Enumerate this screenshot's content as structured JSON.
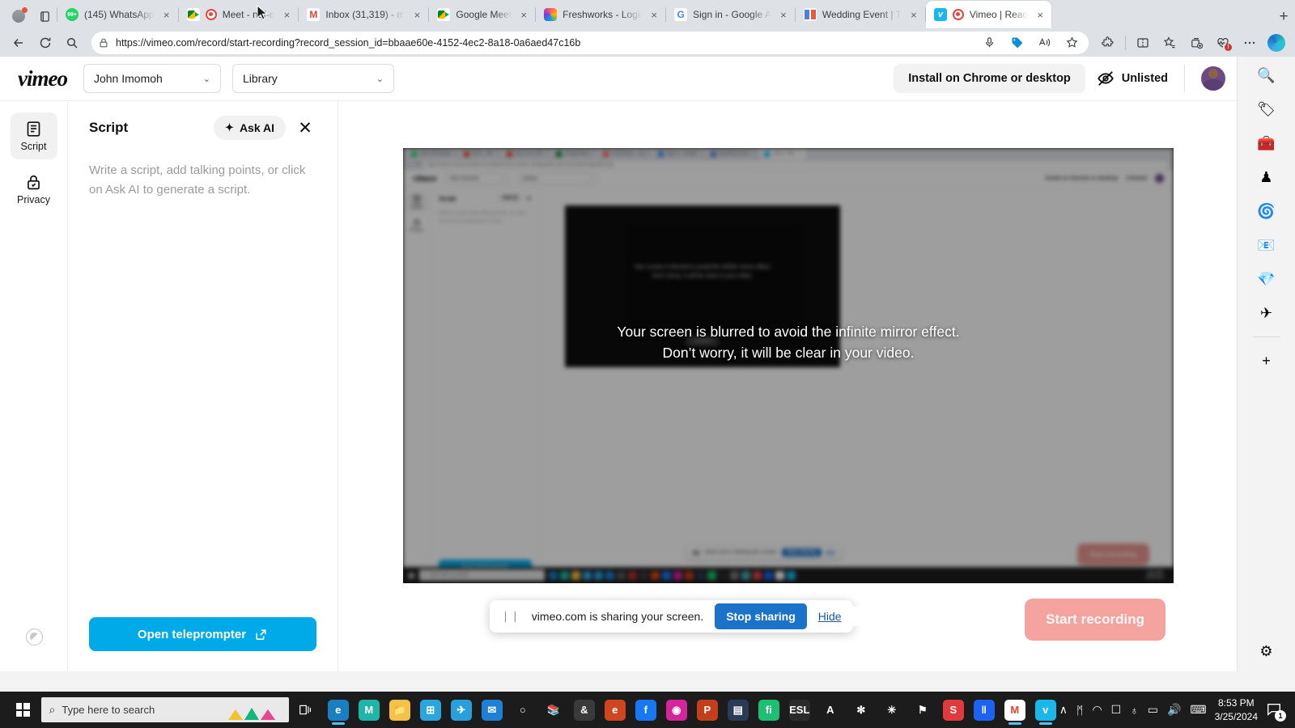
{
  "browser": {
    "tabs": [
      {
        "title": "(145) WhatsApp",
        "favicon": "whatsapp-icon",
        "active": false
      },
      {
        "title": "Meet - nqf-q",
        "favicon": "meet-recording-icon",
        "active": false
      },
      {
        "title": "Inbox (31,319) - m",
        "favicon": "gmail-icon",
        "active": false
      },
      {
        "title": "Google Meet",
        "favicon": "meet-icon",
        "active": false
      },
      {
        "title": "Freshworks - Login",
        "favicon": "freshworks-icon",
        "active": false
      },
      {
        "title": "Sign in - Google A",
        "favicon": "google-icon",
        "active": false
      },
      {
        "title": "Wedding Event | T",
        "favicon": "book-icon",
        "active": false
      },
      {
        "title": "Vimeo | Read",
        "favicon": "vimeo-icon",
        "active": true
      }
    ],
    "tab_close_label": "×",
    "new_tab_label": "+",
    "url": "https://vimeo.com/record/start-recording?record_session_id=bbaae60e-4152-4ec2-8a18-0a6aed47c16b",
    "back_label": "←",
    "refresh_label": "↻",
    "search_label": "⌕"
  },
  "vimeo": {
    "logo": "vimeo",
    "account_select": "John Imomoh",
    "library_select": "Library",
    "caret": "∨",
    "install_button": "Install on Chrome or desktop",
    "privacy_status": "Unlisted",
    "rail": [
      {
        "label": "Script",
        "icon": "script-icon",
        "active": true
      },
      {
        "label": "Privacy",
        "icon": "lock-icon",
        "active": false
      }
    ],
    "script_panel": {
      "title": "Script",
      "ask_ai": "Ask AI",
      "sparkle": "✦",
      "close": "✕",
      "placeholder": "Write a script, add talking points, or click on Ask AI to generate a script.",
      "teleprompter_button": "Open teleprompter"
    },
    "preview": {
      "overlay_line1": "Your screen is blurred to avoid the infinite mirror effect.",
      "overlay_line2": "Don’t worry, it will be clear in your video.",
      "nested_cancel": "Cancel"
    },
    "start_recording": "Start recording"
  },
  "share_bar": {
    "pause_glyph": "❘❘",
    "message": "vimeo.com is sharing your screen.",
    "stop_label": "Stop sharing",
    "hide_label": "Hide"
  },
  "edge_sidebar": {
    "items": [
      {
        "name": "search-icon",
        "glyph": "🔍"
      },
      {
        "name": "shopping-tag-icon",
        "glyph": "🏷"
      },
      {
        "name": "tools-icon",
        "glyph": "🧰"
      },
      {
        "name": "games-icon",
        "glyph": "♟"
      },
      {
        "name": "office-icon",
        "glyph": "🌀"
      },
      {
        "name": "outlook-icon",
        "glyph": "📧"
      },
      {
        "name": "drop-icon",
        "glyph": "💎"
      },
      {
        "name": "telegram-icon",
        "glyph": "✈"
      }
    ],
    "add_label": "+",
    "settings_glyph": "⚙"
  },
  "taskbar": {
    "search_placeholder": "Type here to search",
    "search_glyph": "⌕",
    "apps": [
      {
        "name": "edge-icon",
        "glyph": "e",
        "color": "#1a7fc1",
        "running": true
      },
      {
        "name": "mw-icon",
        "glyph": "M",
        "color": "#1fb5a8",
        "running": false
      },
      {
        "name": "file-explorer-icon",
        "glyph": "📁",
        "color": "#f5c148",
        "running": false
      },
      {
        "name": "microsoft-store-icon",
        "glyph": "⊞",
        "color": "#2aa5dd",
        "running": false
      },
      {
        "name": "telegram-icon",
        "glyph": "✈",
        "color": "#2aa0da",
        "running": false
      },
      {
        "name": "mail-icon",
        "glyph": "✉",
        "color": "#1e7fd6",
        "running": false
      },
      {
        "name": "photos-icon",
        "glyph": "○",
        "color": "#1c1c1c",
        "running": false
      },
      {
        "name": "books-icon",
        "glyph": "📚",
        "color": "#1c1c1c",
        "running": false
      },
      {
        "name": "ampersand-icon",
        "glyph": "&",
        "color": "#3a3a3a",
        "running": false
      },
      {
        "name": "opera-icon",
        "glyph": "e",
        "color": "#cf4520",
        "running": false
      },
      {
        "name": "facebook-icon",
        "glyph": "f",
        "color": "#1877f2",
        "running": false
      },
      {
        "name": "instagram-icon",
        "glyph": "◉",
        "color": "#d6249f",
        "running": false
      },
      {
        "name": "powerpoint-icon",
        "glyph": "P",
        "color": "#c43e1c",
        "running": false
      },
      {
        "name": "news-icon",
        "glyph": "▤",
        "color": "#2b3a55",
        "running": false
      },
      {
        "name": "fiverr-icon",
        "glyph": "fi",
        "color": "#1dbf73",
        "running": false
      },
      {
        "name": "esl-icon",
        "glyph": "ESL",
        "color": "#2b2b2b",
        "running": false
      },
      {
        "name": "adobe-icon",
        "glyph": "A",
        "color": "#1c1c1c",
        "running": false
      },
      {
        "name": "settings-flower-icon",
        "glyph": "✻",
        "color": "#1c1c1c",
        "running": false
      },
      {
        "name": "slack-icon",
        "glyph": "✳",
        "color": "#1c1c1c",
        "running": false
      },
      {
        "name": "flag-icon",
        "glyph": "⚑",
        "color": "#1c1c1c",
        "running": false
      },
      {
        "name": "scribd-icon",
        "glyph": "S",
        "color": "#e03a3e",
        "running": false
      },
      {
        "name": "elementor-icon",
        "glyph": "‖",
        "color": "#1d62f0",
        "running": false
      },
      {
        "name": "gmail-icon",
        "glyph": "M",
        "color": "#ffffff",
        "running": true
      },
      {
        "name": "vimeo-icon",
        "glyph": "v",
        "color": "#1ab7ea",
        "running": true
      }
    ],
    "tray": [
      {
        "name": "show-hidden-icons",
        "glyph": "∧"
      },
      {
        "name": "bluetooth-icon",
        "glyph": "ᛗ"
      },
      {
        "name": "wifi-icon",
        "glyph": "◠"
      },
      {
        "name": "camera-icon",
        "glyph": "☐"
      },
      {
        "name": "microphone-icon",
        "glyph": "♁"
      },
      {
        "name": "battery-icon",
        "glyph": "▭"
      },
      {
        "name": "volume-icon",
        "glyph": "🔊"
      },
      {
        "name": "keyboard-icon",
        "glyph": "⌨"
      }
    ],
    "time": "8:53 PM",
    "date": "3/25/2024",
    "notification_count": "1"
  },
  "mirror": {
    "tabs": [
      "(145) WhatsApp",
      "Meet - nqf-",
      "Inbox (31,319)",
      "Google Meet",
      "Freshworks - Log",
      "Sign in - Google",
      "Wedding Event |",
      "Vimeo | Rec"
    ],
    "url": "https://vimeo.com/record/start-recording?record_session_id=bbaae60e-4152-4ec2-8a18-0a6aed47c16b",
    "logo": "vimeo",
    "account": "John Imomoh",
    "library": "Library",
    "install": "Install on Chrome or desktop",
    "unlisted": "Unlisted",
    "rail": [
      "Script",
      "Privacy"
    ],
    "script_title": "Script",
    "ask_ai": "Ask AI",
    "placeholder": "Write a script, add talking points, or click on Ask AI to generate a script.",
    "teleprompter": "Open teleprompter",
    "overlay1": "Your screen is blurred to avoid the infinite mirror effect.",
    "overlay2": "Don’t worry, it will be clear in your video.",
    "cancel": "Cancel",
    "share_msg": "vimeo.com is sharing your screen.",
    "stop": "Stop sharing",
    "hide": "Hide",
    "start": "Start recording",
    "search": "Type here to search",
    "time": "8:53 PM",
    "date": "3/25/2024"
  },
  "colors": {
    "vimeo_blue": "#00a9e8",
    "chrome_tabbar": "#dee1e6",
    "taskbar": "#1c1c1c",
    "start_rec_disabled": "#f4a39f",
    "stop_sharing_blue": "#1a73c8"
  }
}
